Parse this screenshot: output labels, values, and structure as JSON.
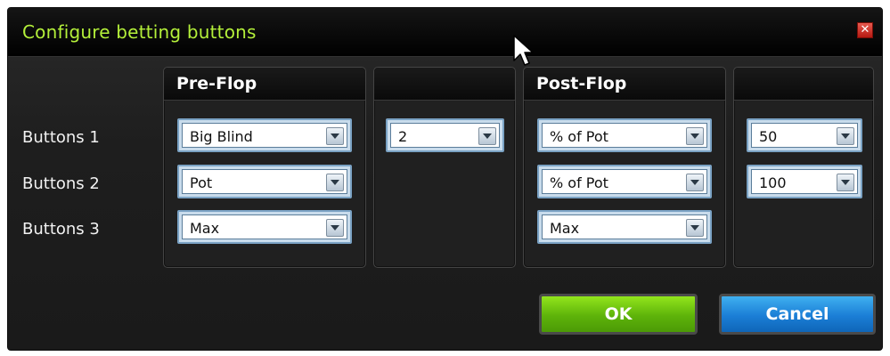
{
  "dialog": {
    "title": "Configure betting buttons",
    "close_label": "✕"
  },
  "rows": [
    "Buttons 1",
    "Buttons 2",
    "Buttons 3"
  ],
  "pre_flop": {
    "header": "Pre-Flop",
    "selects": [
      "Big Blind",
      "Pot",
      "Max"
    ],
    "amount_selects": [
      "2"
    ]
  },
  "post_flop": {
    "header": "Post-Flop",
    "selects": [
      "% of Pot",
      "% of Pot",
      "Max"
    ],
    "amount_selects": [
      "50",
      "100"
    ]
  },
  "buttons": {
    "ok": "OK",
    "cancel": "Cancel"
  },
  "colors": {
    "title": "#b4f03a",
    "ok": "#5eb30a",
    "cancel": "#1b7ed6",
    "close": "#c9281d"
  }
}
